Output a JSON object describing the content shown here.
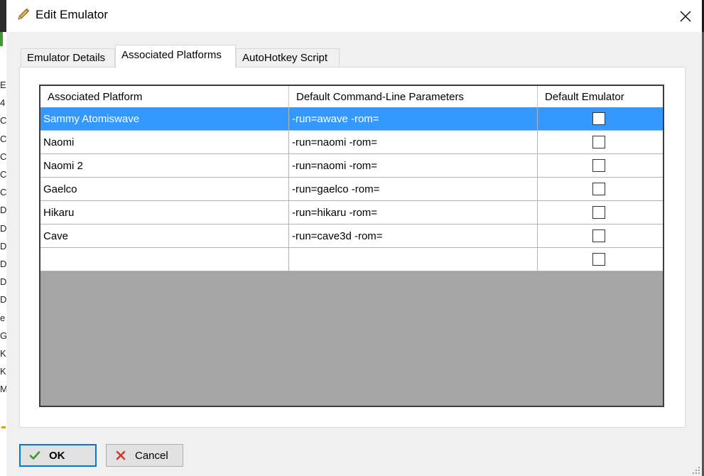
{
  "window": {
    "title": "Edit Emulator",
    "title_icon": "pencil-icon",
    "close_icon": "close-icon"
  },
  "background_letters": [
    "E",
    "4",
    "C",
    "C",
    "C",
    "C",
    "C",
    "D",
    "D",
    "D",
    "D",
    "D",
    "D",
    "e",
    "G",
    "K",
    "K",
    "M"
  ],
  "tabs": [
    {
      "label": "Emulator Details",
      "active": false
    },
    {
      "label": "Associated Platforms",
      "active": true
    },
    {
      "label": "AutoHotkey Script",
      "active": false
    }
  ],
  "grid": {
    "columns": [
      "Associated Platform",
      "Default Command-Line Parameters",
      "Default Emulator"
    ],
    "rows": [
      {
        "platform": "Sammy Atomiswave",
        "params": "-run=awave -rom=",
        "default": false,
        "selected": true
      },
      {
        "platform": "Naomi",
        "params": "-run=naomi -rom=",
        "default": false,
        "selected": false
      },
      {
        "platform": "Naomi 2",
        "params": "-run=naomi -rom=",
        "default": false,
        "selected": false
      },
      {
        "platform": "Gaelco",
        "params": "-run=gaelco -rom=",
        "default": false,
        "selected": false
      },
      {
        "platform": "Hikaru",
        "params": "-run=hikaru -rom=",
        "default": false,
        "selected": false
      },
      {
        "platform": "Cave",
        "params": "-run=cave3d -rom=",
        "default": false,
        "selected": false
      },
      {
        "platform": "",
        "params": "",
        "default": false,
        "selected": false
      }
    ]
  },
  "buttons": {
    "ok": {
      "label": "OK",
      "icon": "checkmark-icon"
    },
    "cancel": {
      "label": "Cancel",
      "icon": "x-icon"
    }
  },
  "colors": {
    "selection": "#3399ff",
    "ok_border": "#0078d7",
    "grid_empty": "#a5a5a5"
  }
}
